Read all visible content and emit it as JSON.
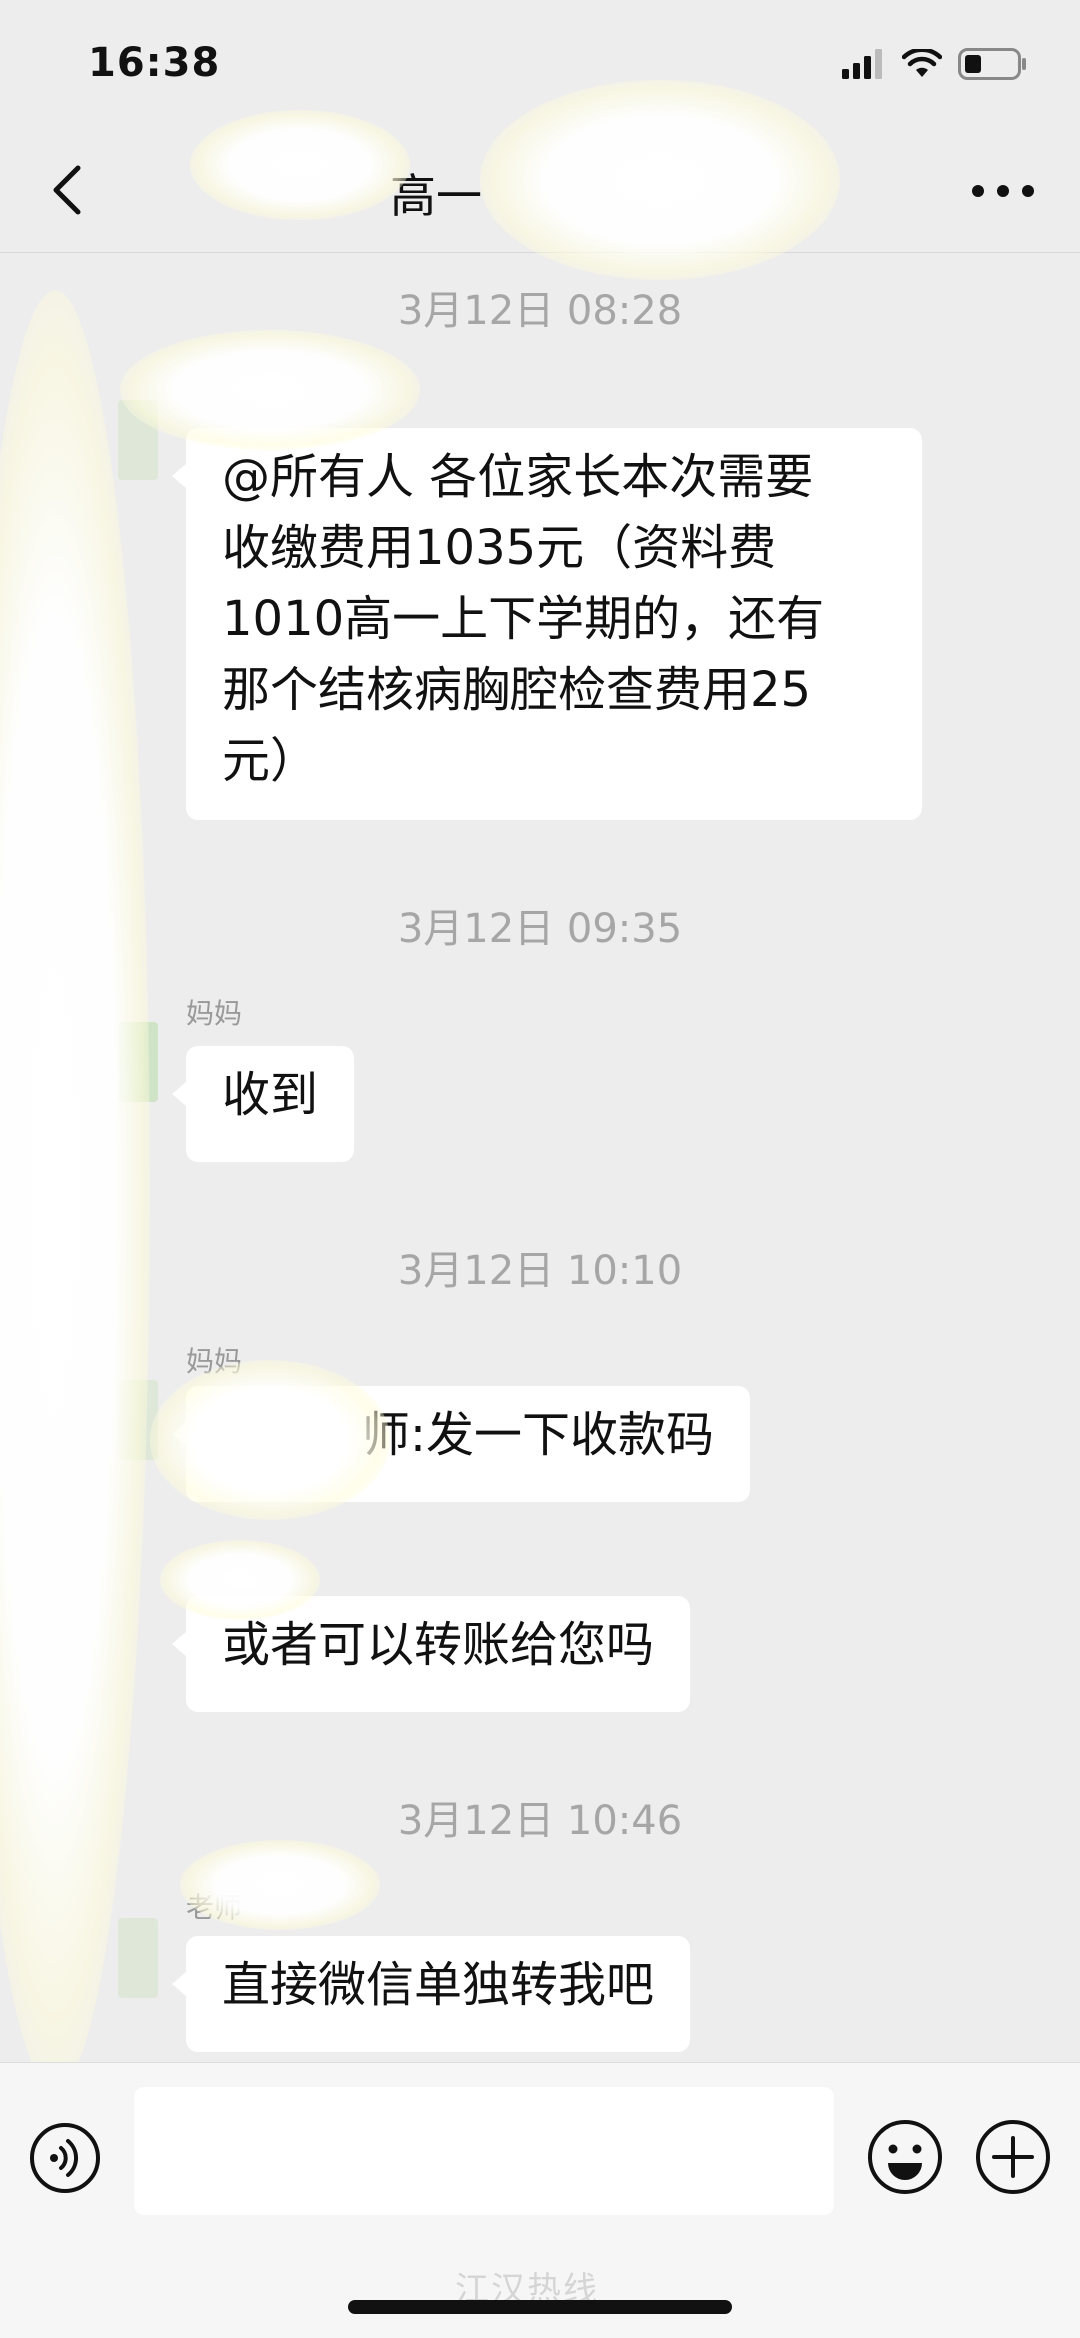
{
  "status_bar": {
    "time": "16:38",
    "icons": [
      "signal-icon",
      "wifi-icon",
      "battery-icon"
    ]
  },
  "nav": {
    "title": "高一",
    "back_icon": "chevron-left-icon",
    "more_icon": "more-icon"
  },
  "messages": [
    {
      "time": "3月12日 08:28",
      "sender": "",
      "text_lines": [
        "@所有人 各位家长本次需要",
        "收缴费用1035元（资料费",
        "1010高一上下学期的，还有",
        "那个结核病胸腔检查费用25",
        "元）"
      ]
    },
    {
      "time": "3月12日 09:35",
      "sender": "妈妈",
      "text_lines": [
        "收到"
      ]
    },
    {
      "time": "3月12日 10:10",
      "sender": "妈妈",
      "text_lines": [
        "师:发一下收款码"
      ]
    },
    {
      "time": "",
      "sender": "",
      "text_lines": [
        "或者可以转账给您吗"
      ]
    },
    {
      "time": "3月12日 10:46",
      "sender": "老师",
      "text_lines": [
        "直接微信单独转我吧"
      ]
    }
  ],
  "input_bar": {
    "voice_icon": "voice-icon",
    "emoji_icon": "emoji-icon",
    "plus_icon": "plus-icon",
    "placeholder": ""
  },
  "watermark": "江汉热线"
}
